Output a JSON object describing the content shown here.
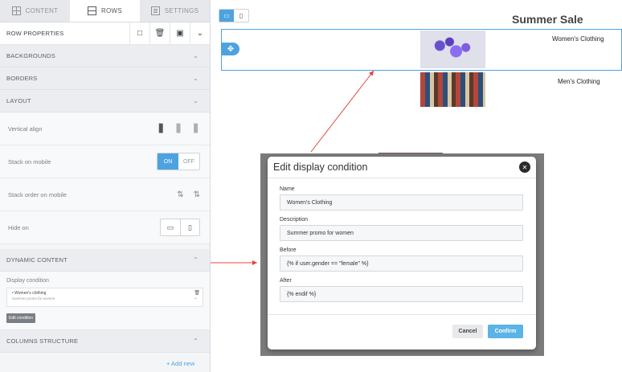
{
  "sidebar": {
    "tabs": [
      {
        "label": "CONTENT",
        "icon": "grid-icon"
      },
      {
        "label": "ROWS",
        "icon": "rows-icon"
      },
      {
        "label": "SETTINGS",
        "icon": "settings-icon"
      }
    ],
    "row_properties": {
      "label": "ROW PROPERTIES",
      "icons": [
        "comment-icon",
        "trash-icon",
        "copy-icon",
        "chevron-down-icon"
      ]
    },
    "sections": {
      "backgrounds": "BACKGROUNDS",
      "borders": "BORDERS",
      "layout": "LAYOUT",
      "dynamic_content": "DYNAMIC CONTENT",
      "columns_structure": "COLUMNS STRUCTURE"
    },
    "layout": {
      "vertical_align": "Vertical align",
      "stack_on_mobile": "Stack on mobile",
      "toggle_on": "ON",
      "toggle_off": "OFF",
      "stack_order": "Stack order on mobile",
      "hide_on": "Hide on"
    },
    "dynamic": {
      "display_condition_label": "Display condition",
      "condition_name": "• Women's clothing",
      "condition_desc": "Summer promo for women",
      "edit_button": "Edit condition"
    },
    "add_new": "+ Add new"
  },
  "canvas": {
    "title": "Summer Sale",
    "women_label": "Women's Clothing",
    "men_label": "Men's Clothing"
  },
  "modal": {
    "title": "Edit display condition",
    "fields": {
      "name_label": "Name",
      "name_value": "Women's Clothing",
      "description_label": "Description",
      "description_value": "Summer promo for women",
      "before_label": "Before",
      "before_value": "{% if user.gender == \"female\" %}",
      "after_label": "After",
      "after_value": "{% endif %}"
    },
    "cancel": "Cancel",
    "confirm": "Confirm"
  },
  "colors": {
    "accent": "#4da3e0",
    "arrow": "#e0483c"
  }
}
